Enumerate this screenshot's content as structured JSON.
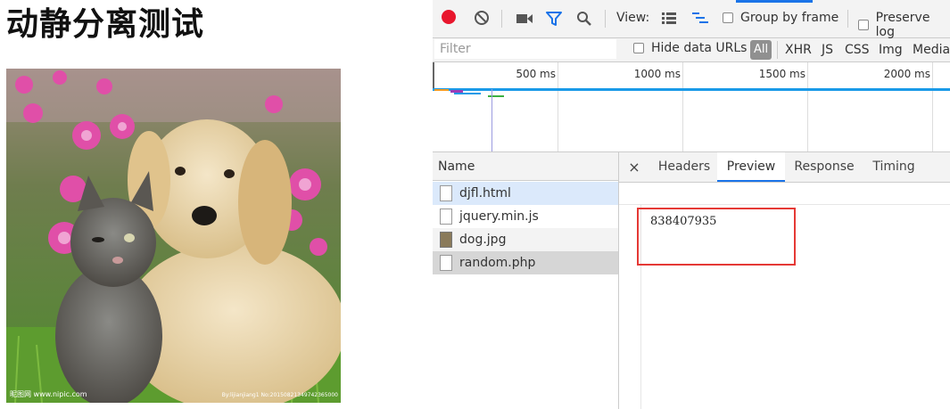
{
  "page": {
    "title": "动静分离测试",
    "image": {
      "watermark_left": "昵图网 www.nipic.com",
      "watermark_right": "By:lijianjiang1 No:20150821349742365000"
    }
  },
  "devtools": {
    "toolbar": {
      "view_label": "View:",
      "group_by_frame": "Group by frame",
      "preserve_log": "Preserve log"
    },
    "filter": {
      "placeholder": "Filter",
      "hide_data_urls": "Hide data URLs",
      "types": [
        "All",
        "XHR",
        "JS",
        "CSS",
        "Img",
        "Media"
      ]
    },
    "timeline": {
      "ticks": [
        "500 ms",
        "1000 ms",
        "1500 ms",
        "2000 ms"
      ]
    },
    "requests": {
      "header": "Name",
      "items": [
        {
          "name": "djfl.html",
          "icon": "document-icon"
        },
        {
          "name": "jquery.min.js",
          "icon": "script-icon"
        },
        {
          "name": "dog.jpg",
          "icon": "image-file-icon"
        },
        {
          "name": "random.php",
          "icon": "document-icon"
        }
      ]
    },
    "detail": {
      "close": "×",
      "tabs": [
        "Headers",
        "Preview",
        "Response",
        "Timing"
      ],
      "preview_value": "838407935"
    },
    "colors": {
      "accent": "#1a73e8",
      "record": "#e8162d",
      "highlight": "#e53935"
    }
  }
}
